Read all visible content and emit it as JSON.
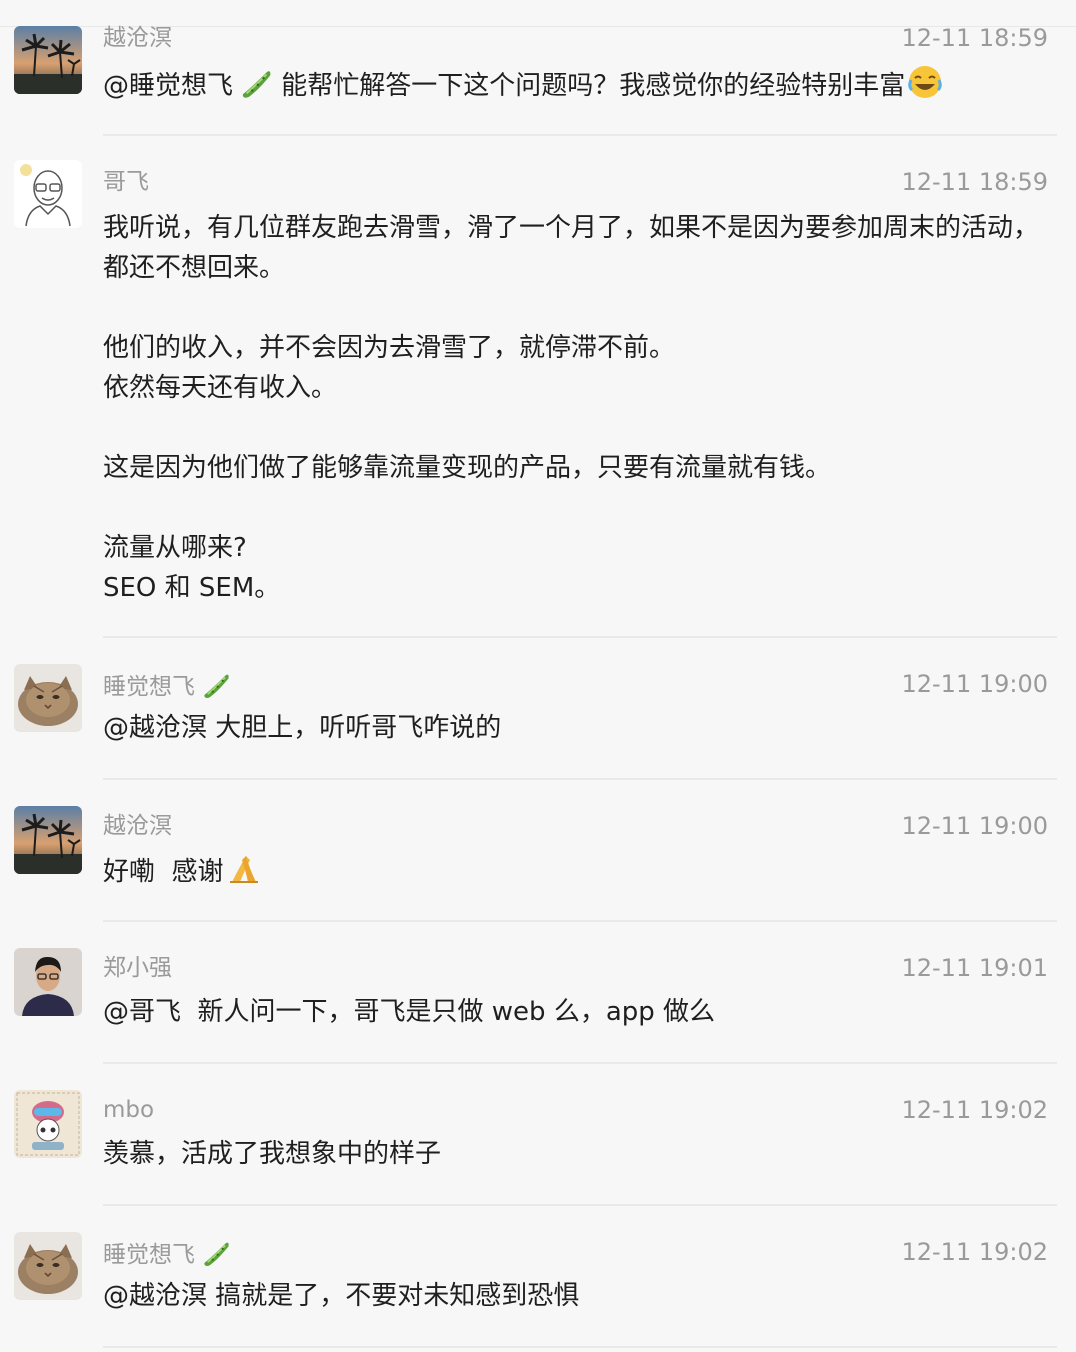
{
  "messages": [
    {
      "sender": "越沧溟",
      "time": "12-11 18:59",
      "avatar_icon": "palm-beach-avatar-icon",
      "text_before": "@睡觉想飞",
      "text_after": " 能帮忙解答一下这个问题吗？我感觉你的经验特别丰富"
    },
    {
      "sender": "哥飞",
      "time": "12-11 18:59",
      "avatar_icon": "bald-man-cartoon-avatar-icon",
      "paragraphs": [
        "我听说，有几位群友跑去滑雪，滑了一个月了，如果不是因为要参加周末的活动，都还不想回来。",
        "他们的收入，并不会因为去滑雪了，就停滞不前。\n依然每天还有收入。",
        "这是因为他们做了能够靠流量变现的产品，只要有流量就有钱。",
        "流量从哪来?\nSEO 和 SEM。"
      ]
    },
    {
      "sender": "睡觉想飞",
      "time": "12-11 19:00",
      "avatar_icon": "cat-avatar-icon",
      "text": "@越沧溟 大胆上，听听哥飞咋说的"
    },
    {
      "sender": "越沧溟",
      "time": "12-11 19:00",
      "avatar_icon": "palm-beach-avatar-icon",
      "text": "好嘞  感谢"
    },
    {
      "sender": "郑小强",
      "time": "12-11 19:01",
      "avatar_icon": "man-photo-avatar-icon",
      "text": "@哥飞  新人问一下，哥飞是只做 web 么，app 做么"
    },
    {
      "sender": "mbo",
      "time": "12-11 19:02",
      "avatar_icon": "cartoon-stamp-avatar-icon",
      "text": "羡慕，活成了我想象中的样子"
    },
    {
      "sender": "睡觉想飞",
      "time": "12-11 19:02",
      "avatar_icon": "cat-avatar-icon",
      "text": "@越沧溟 搞就是了，不要对未知感到恐惧"
    }
  ]
}
